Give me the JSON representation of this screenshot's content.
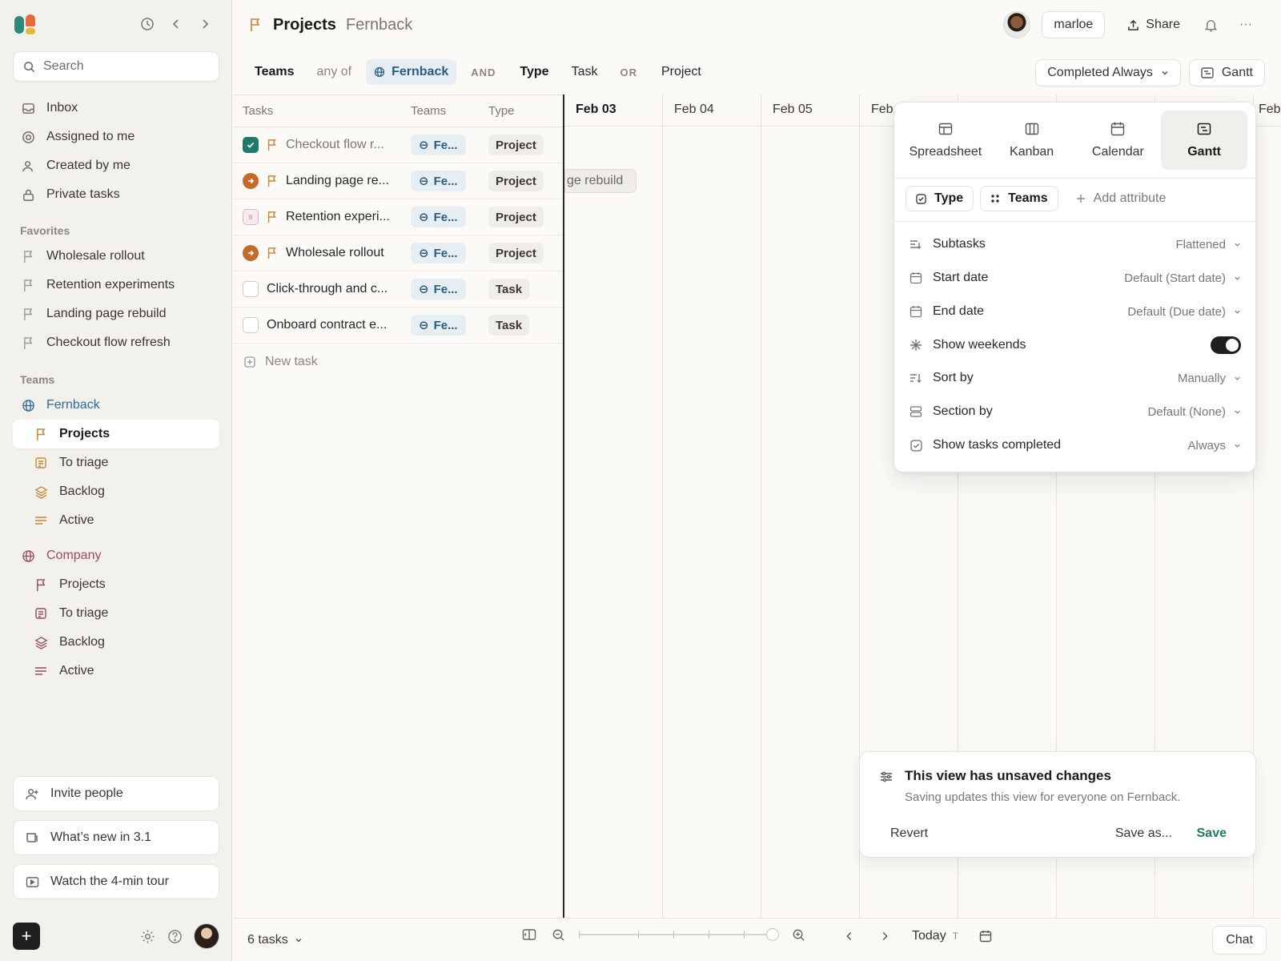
{
  "colors": {
    "accent": "#1f7a6a",
    "team_blue": "#2b5c7f",
    "team_rose": "#9a4a6a",
    "flag": "#c6853b",
    "active_status": "#c56a2a"
  },
  "sidebar": {
    "search_placeholder": "Search",
    "nav": [
      {
        "label": "Inbox",
        "icon": "inbox-icon"
      },
      {
        "label": "Assigned to me",
        "icon": "target-icon"
      },
      {
        "label": "Created by me",
        "icon": "user-icon"
      },
      {
        "label": "Private tasks",
        "icon": "lock-icon"
      }
    ],
    "favorites_label": "Favorites",
    "favorites": [
      {
        "label": "Wholesale rollout"
      },
      {
        "label": "Retention experiments"
      },
      {
        "label": "Landing page rebuild"
      },
      {
        "label": "Checkout flow refresh"
      }
    ],
    "teams_label": "Teams",
    "teams": [
      {
        "name": "Fernback",
        "items": [
          "Projects",
          "To triage",
          "Backlog",
          "Active"
        ],
        "active_item": "Projects"
      },
      {
        "name": "Company",
        "items": [
          "Projects",
          "To triage",
          "Backlog",
          "Active"
        ]
      }
    ],
    "bottom": {
      "invite": "Invite people",
      "whats_new": "What’s new in 3.1",
      "tour": "Watch the 4-min tour"
    },
    "new_button": "+"
  },
  "header": {
    "title": "Projects",
    "subtitle": "Fernback",
    "user": "marloe",
    "share": "Share",
    "more": "···"
  },
  "filters": {
    "field1": "Teams",
    "op1": "any of",
    "value1": "Fernback",
    "and": "AND",
    "field2": "Type",
    "value2a": "Task",
    "or": "OR",
    "value2b": "Project",
    "completed_dropdown": "Completed Always",
    "view_button": "Gantt"
  },
  "table": {
    "headers": [
      "Tasks",
      "Teams",
      "Type"
    ],
    "rows": [
      {
        "name": "Checkout flow r...",
        "team": "Fe...",
        "type": "Project",
        "status": "done",
        "flag": true
      },
      {
        "name": "Landing page re...",
        "team": "Fe...",
        "type": "Project",
        "status": "active",
        "flag": true
      },
      {
        "name": "Retention experi...",
        "team": "Fe...",
        "type": "Project",
        "status": "paused",
        "flag": true
      },
      {
        "name": "Wholesale rollout",
        "team": "Fe...",
        "type": "Project",
        "status": "active",
        "flag": true
      },
      {
        "name": "Click-through and c...",
        "team": "Fe...",
        "type": "Task",
        "status": "empty",
        "flag": false
      },
      {
        "name": "Onboard contract e...",
        "team": "Fe...",
        "type": "Task",
        "status": "empty",
        "flag": false
      }
    ],
    "new_task": "New task"
  },
  "gantt": {
    "dates": [
      "Feb 03",
      "Feb 04",
      "Feb 05",
      "Feb",
      "",
      "",
      "",
      "Feb"
    ],
    "today_index": 0,
    "bar_label": "ge rebuild"
  },
  "popover": {
    "views": [
      {
        "label": "Spreadsheet",
        "icon": "spreadsheet-icon"
      },
      {
        "label": "Kanban",
        "icon": "kanban-icon"
      },
      {
        "label": "Calendar",
        "icon": "calendar-icon"
      },
      {
        "label": "Gantt",
        "icon": "gantt-icon",
        "selected": true
      }
    ],
    "attributes": [
      "Type",
      "Teams"
    ],
    "add_attribute": "Add attribute",
    "settings": [
      {
        "label": "Subtasks",
        "value": "Flattened"
      },
      {
        "label": "Start date",
        "value": "Default (Start date)"
      },
      {
        "label": "End date",
        "value": "Default (Due date)"
      },
      {
        "label": "Show weekends",
        "toggle": true
      },
      {
        "label": "Sort by",
        "value": "Manually"
      },
      {
        "label": "Section by",
        "value": "Default (None)"
      },
      {
        "label": "Show tasks completed",
        "value": "Always"
      }
    ]
  },
  "unsaved": {
    "title": "This view has unsaved changes",
    "description": "Saving updates this view for everyone on Fernback.",
    "revert": "Revert",
    "save_as": "Save as...",
    "save": "Save"
  },
  "bottombar": {
    "task_count": "6 tasks",
    "today": "Today",
    "today_key": "T",
    "chat": "Chat",
    "zoom_level": 1.0
  }
}
